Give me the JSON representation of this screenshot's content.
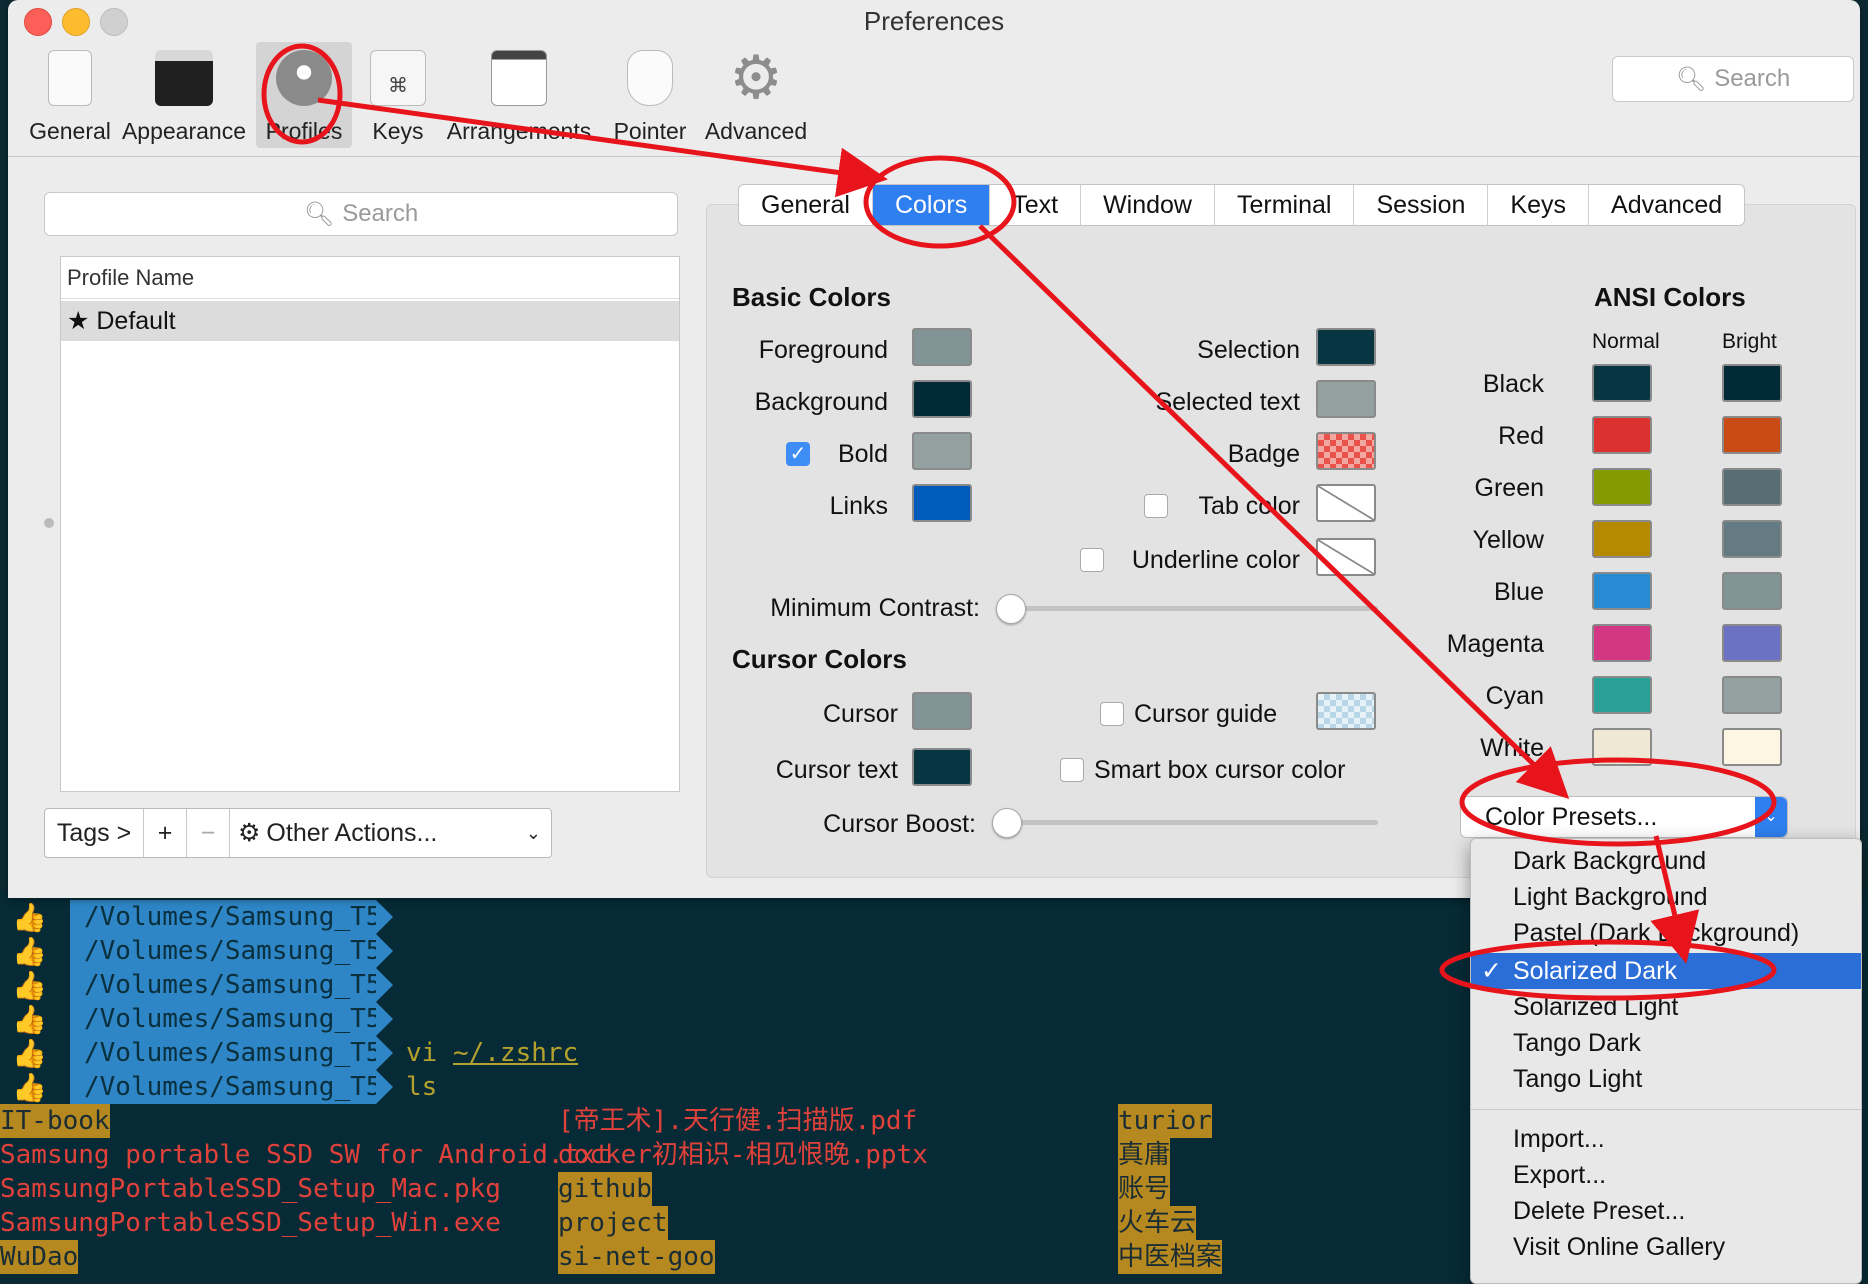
{
  "window": {
    "title": "Preferences"
  },
  "toolbar": {
    "items": [
      "General",
      "Appearance",
      "Profiles",
      "Keys",
      "Arrangements",
      "Pointer",
      "Advanced"
    ],
    "search_placeholder": "Search"
  },
  "profiles_panel": {
    "search_placeholder": "Search",
    "column_header": "Profile Name",
    "rows": [
      "★ Default"
    ],
    "tags_label": "Tags >",
    "add_label": "+",
    "remove_label": "−",
    "other_actions_label": "Other Actions..."
  },
  "tabs": {
    "items": [
      "General",
      "Colors",
      "Text",
      "Window",
      "Terminal",
      "Session",
      "Keys",
      "Advanced"
    ],
    "active": "Colors"
  },
  "basic_colors": {
    "title": "Basic Colors",
    "foreground": "Foreground",
    "background": "Background",
    "bold": "Bold",
    "links": "Links",
    "selection": "Selection",
    "selected_text": "Selected text",
    "badge": "Badge",
    "tab_color": "Tab color",
    "underline_color": "Underline color",
    "minimum_contrast": "Minimum Contrast:",
    "colors": {
      "foreground": "#839496",
      "background": "#002b36",
      "bold": "#93a1a1",
      "links": "#005bbb",
      "selection": "#073642",
      "selected_text": "#93a1a1"
    }
  },
  "cursor_colors": {
    "title": "Cursor Colors",
    "cursor": "Cursor",
    "cursor_text": "Cursor text",
    "cursor_guide": "Cursor guide",
    "smart_box": "Smart box cursor color",
    "cursor_boost": "Cursor Boost:",
    "colors": {
      "cursor": "#839496",
      "cursor_text": "#073642"
    }
  },
  "ansi": {
    "title": "ANSI Colors",
    "normal": "Normal",
    "bright": "Bright",
    "rows": [
      {
        "name": "Black",
        "normal": "#073642",
        "bright": "#002b36"
      },
      {
        "name": "Red",
        "normal": "#dc322f",
        "bright": "#cb4b16"
      },
      {
        "name": "Green",
        "normal": "#859900",
        "bright": "#586e75"
      },
      {
        "name": "Yellow",
        "normal": "#b58900",
        "bright": "#657b83"
      },
      {
        "name": "Blue",
        "normal": "#268bd2",
        "bright": "#839496"
      },
      {
        "name": "Magenta",
        "normal": "#d33682",
        "bright": "#6c71c4"
      },
      {
        "name": "Cyan",
        "normal": "#2aa198",
        "bright": "#93a1a1"
      },
      {
        "name": "White",
        "normal": "#eee8d5",
        "bright": "#fdf6e3"
      }
    ]
  },
  "presets": {
    "button_label": "Color Presets...",
    "items": [
      "Dark Background",
      "Light Background",
      "Pastel (Dark Background)",
      "Solarized Dark",
      "Solarized Light",
      "Tango Dark",
      "Tango Light"
    ],
    "selected": "Solarized Dark",
    "check": "✓",
    "actions": [
      "Import...",
      "Export...",
      "Delete Preset...",
      "Visit Online Gallery"
    ]
  },
  "terminal": {
    "prompt_icon": "👍",
    "path": "/Volumes/Samsung_T5",
    "cmd1_a": "vi ",
    "cmd1_b": "~/.zshrc",
    "cmd2": "ls",
    "col1": [
      "IT-book",
      "Samsung portable SSD SW for Android.txt",
      "SamsungPortableSSD_Setup_Mac.pkg",
      "SamsungPortableSSD_Setup_Win.exe",
      "WuDao"
    ],
    "col2": [
      "[帝王术].天行健.扫描版.pdf",
      "docker初相识-相见恨晚.pptx",
      "github",
      "project",
      "si-net-goo"
    ],
    "col3": [
      "turior",
      "真庸",
      "账号",
      "火车云",
      "中医档案"
    ]
  }
}
